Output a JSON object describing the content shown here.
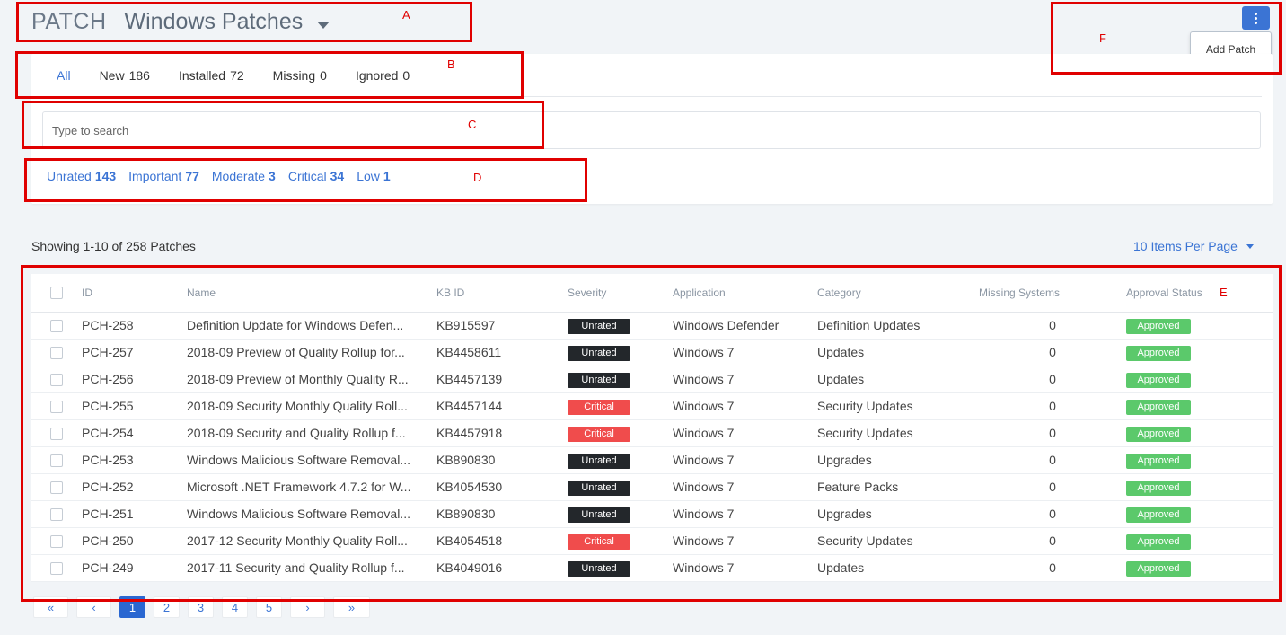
{
  "header": {
    "module": "PATCH",
    "title": "Windows Patches"
  },
  "actions": {
    "menu_items": [
      "Add Patch"
    ]
  },
  "tabs": [
    {
      "label": "All",
      "count": ""
    },
    {
      "label": "New",
      "count": "186"
    },
    {
      "label": "Installed",
      "count": "72"
    },
    {
      "label": "Missing",
      "count": "0"
    },
    {
      "label": "Ignored",
      "count": "0"
    }
  ],
  "search": {
    "placeholder": "Type to search",
    "value": ""
  },
  "severity_filters": [
    {
      "label": "Unrated",
      "count": "143"
    },
    {
      "label": "Important",
      "count": "77"
    },
    {
      "label": "Moderate",
      "count": "3"
    },
    {
      "label": "Critical",
      "count": "34"
    },
    {
      "label": "Low",
      "count": "1"
    }
  ],
  "summary": {
    "showing": "Showing 1-10 of 258 Patches",
    "per_page": "10 Items Per Page"
  },
  "table": {
    "columns": [
      "ID",
      "Name",
      "KB ID",
      "Severity",
      "Application",
      "Category",
      "Missing Systems",
      "Approval Status"
    ],
    "rows": [
      {
        "id": "PCH-258",
        "name": "Definition Update for Windows Defen...",
        "kb": "KB915597",
        "severity": "Unrated",
        "application": "Windows Defender",
        "category": "Definition Updates",
        "missing": "0",
        "status": "Approved"
      },
      {
        "id": "PCH-257",
        "name": "2018-09 Preview of Quality Rollup for...",
        "kb": "KB4458611",
        "severity": "Unrated",
        "application": "Windows 7",
        "category": "Updates",
        "missing": "0",
        "status": "Approved"
      },
      {
        "id": "PCH-256",
        "name": "2018-09 Preview of Monthly Quality R...",
        "kb": "KB4457139",
        "severity": "Unrated",
        "application": "Windows 7",
        "category": "Updates",
        "missing": "0",
        "status": "Approved"
      },
      {
        "id": "PCH-255",
        "name": "2018-09 Security Monthly Quality Roll...",
        "kb": "KB4457144",
        "severity": "Critical",
        "application": "Windows 7",
        "category": "Security Updates",
        "missing": "0",
        "status": "Approved"
      },
      {
        "id": "PCH-254",
        "name": "2018-09 Security and Quality Rollup f...",
        "kb": "KB4457918",
        "severity": "Critical",
        "application": "Windows 7",
        "category": "Security Updates",
        "missing": "0",
        "status": "Approved"
      },
      {
        "id": "PCH-253",
        "name": "Windows Malicious Software Removal...",
        "kb": "KB890830",
        "severity": "Unrated",
        "application": "Windows 7",
        "category": "Upgrades",
        "missing": "0",
        "status": "Approved"
      },
      {
        "id": "PCH-252",
        "name": "Microsoft .NET Framework 4.7.2 for W...",
        "kb": "KB4054530",
        "severity": "Unrated",
        "application": "Windows 7",
        "category": "Feature Packs",
        "missing": "0",
        "status": "Approved"
      },
      {
        "id": "PCH-251",
        "name": "Windows Malicious Software Removal...",
        "kb": "KB890830",
        "severity": "Unrated",
        "application": "Windows 7",
        "category": "Upgrades",
        "missing": "0",
        "status": "Approved"
      },
      {
        "id": "PCH-250",
        "name": "2017-12 Security Monthly Quality Roll...",
        "kb": "KB4054518",
        "severity": "Critical",
        "application": "Windows 7",
        "category": "Security Updates",
        "missing": "0",
        "status": "Approved"
      },
      {
        "id": "PCH-249",
        "name": "2017-11 Security and Quality Rollup f...",
        "kb": "KB4049016",
        "severity": "Unrated",
        "application": "Windows 7",
        "category": "Updates",
        "missing": "0",
        "status": "Approved"
      }
    ]
  },
  "pagination": {
    "first": "«",
    "prev": "‹",
    "pages": [
      "1",
      "2",
      "3",
      "4",
      "5"
    ],
    "current": "1",
    "next": "›",
    "last": "»"
  },
  "annotations": [
    "A",
    "B",
    "C",
    "D",
    "E",
    "F"
  ],
  "colors": {
    "accent": "#3b74d4",
    "critical": "#f04c4c",
    "unrated": "#23272b",
    "approved": "#5bc96b",
    "annotation": "#e00000"
  }
}
